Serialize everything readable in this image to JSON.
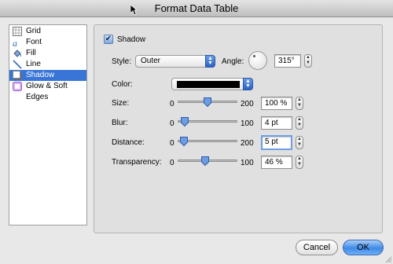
{
  "window": {
    "title": "Format Data Table"
  },
  "sidebar": {
    "items": [
      {
        "label": "Grid",
        "icon": "grid-icon",
        "selected": false
      },
      {
        "label": "Font",
        "icon": "font-icon",
        "selected": false
      },
      {
        "label": "Fill",
        "icon": "fill-bucket-icon",
        "selected": false
      },
      {
        "label": "Line",
        "icon": "line-icon",
        "selected": false
      },
      {
        "label": "Shadow",
        "icon": "shadow-icon",
        "selected": true
      },
      {
        "label": "Glow & Soft Edges",
        "icon": "glow-icon",
        "selected": false
      }
    ]
  },
  "shadow": {
    "checkbox_label": "Shadow",
    "checked": true,
    "style_label": "Style:",
    "style_value": "Outer",
    "angle_label": "Angle:",
    "angle_value": "315°",
    "color_label": "Color:",
    "color_value": "#000000",
    "sliders": [
      {
        "label": "Size:",
        "min": "0",
        "max": "200",
        "value": "100 %",
        "position": 0.5
      },
      {
        "label": "Blur:",
        "min": "0",
        "max": "100",
        "value": "4 pt",
        "position": 0.04
      },
      {
        "label": "Distance:",
        "min": "0",
        "max": "200",
        "value": "5 pt",
        "position": 0.025
      },
      {
        "label": "Transparency:",
        "min": "0",
        "max": "100",
        "value": "46 %",
        "position": 0.46
      }
    ]
  },
  "buttons": {
    "cancel": "Cancel",
    "ok": "OK"
  },
  "colors": {
    "selection": "#3875d7",
    "accent": "#4a8fe7"
  }
}
